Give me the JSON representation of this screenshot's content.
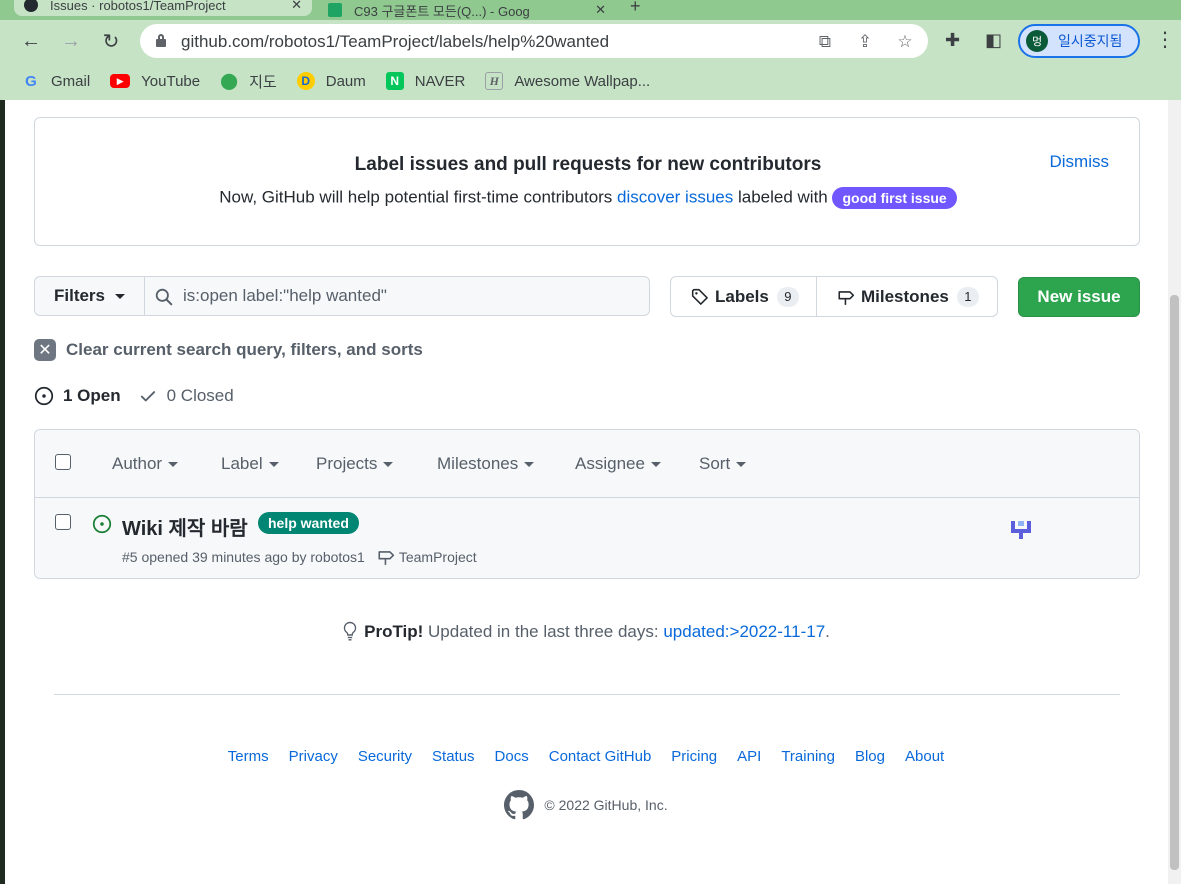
{
  "browser": {
    "tabs": [
      {
        "title": "Issues · robotos1/TeamProject",
        "active": true
      },
      {
        "title": "C93 구글폰트 모든(Q...) - Goog",
        "active": false
      }
    ],
    "url": "github.com/robotos1/TeamProject/labels/help%20wanted",
    "profile_initial": "멍",
    "profile_label": "일시중지됨",
    "bookmarks": [
      {
        "label": "Gmail",
        "icon": "gmail-icon"
      },
      {
        "label": "YouTube",
        "icon": "youtube-icon"
      },
      {
        "label": "지도",
        "icon": "maps-icon"
      },
      {
        "label": "Daum",
        "icon": "daum-icon"
      },
      {
        "label": "NAVER",
        "icon": "naver-icon"
      },
      {
        "label": "Awesome Wallpap...",
        "icon": "wallpaper-icon"
      }
    ]
  },
  "banner": {
    "title": "Label issues and pull requests for new contributors",
    "desc_before": "Now, GitHub will help potential first-time contributors ",
    "desc_link": "discover issues",
    "desc_after": " labeled with ",
    "label": "good first issue",
    "label_color": "#7057ff",
    "dismiss": "Dismiss"
  },
  "toolbar": {
    "filters_label": "Filters",
    "search_value": "is:open label:\"help wanted\"",
    "labels_label": "Labels",
    "labels_count": "9",
    "milestones_label": "Milestones",
    "milestones_count": "1",
    "new_issue_label": "New issue",
    "new_issue_color": "#2da44e"
  },
  "clear_query": "Clear current search query, filters, and sorts",
  "states": {
    "open": "1 Open",
    "closed": "0 Closed"
  },
  "list_header": {
    "filters": [
      "Author",
      "Label",
      "Projects",
      "Milestones",
      "Assignee",
      "Sort"
    ]
  },
  "issues": [
    {
      "title": "Wiki 제작 바람",
      "label": "help wanted",
      "label_color": "#008672",
      "meta": "#5 opened 39 minutes ago by robotos1",
      "milestone": "TeamProject",
      "state_color": "#1a7f37"
    }
  ],
  "protip": {
    "prefix": "ProTip!",
    "text": " Updated in the last three days: ",
    "link": "updated:>2022-11-17",
    "suffix": "."
  },
  "footer": {
    "links": [
      "Terms",
      "Privacy",
      "Security",
      "Status",
      "Docs",
      "Contact GitHub",
      "Pricing",
      "API",
      "Training",
      "Blog",
      "About"
    ],
    "copyright": "© 2022 GitHub, Inc."
  }
}
